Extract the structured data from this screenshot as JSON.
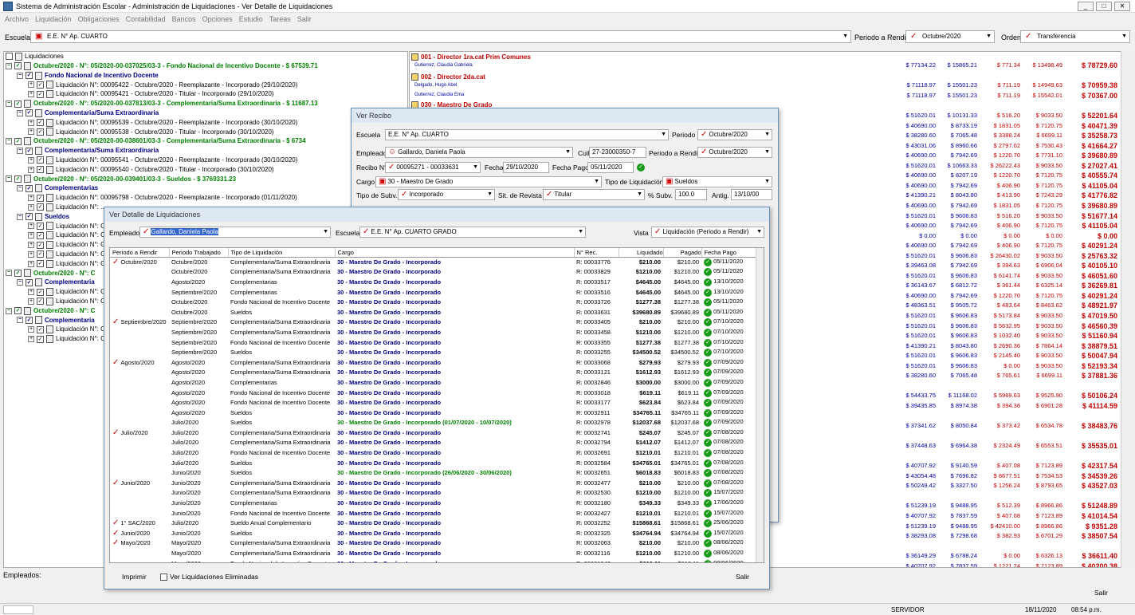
{
  "window": {
    "title": "Sistema de Administración Escolar - Administración de Liquidaciones - Ver Detalle de Liquidaciones"
  },
  "menu": [
    "Archivo",
    "Liquidación",
    "Obligaciones",
    "Contabilidad",
    "Bancos",
    "Opciones",
    "Estudio",
    "Tareas",
    "Salir"
  ],
  "filters": {
    "escuela_label": "Escuela",
    "escuela_value": "E.E. N° Ap. CUARTO",
    "periodo_label": "Periodo a Rendir",
    "periodo_value": "Octubre/2020",
    "orden_label": "Orden",
    "orden_value": "Transferencia"
  },
  "tree": {
    "root": "Liquidaciones",
    "nodes": [
      {
        "t": "Octubre/2020 - N°: 05/2020-00-037025/03-3 - Fondo Nacional de Incentivo Docente - $ 67539.71",
        "k": "green",
        "l": 0
      },
      {
        "t": "Fondo Nacional de Incentivo Docente",
        "k": "blue",
        "l": 1
      },
      {
        "t": "Liquidación N°: 00095422 - Octubre/2020 - Reemplazante - Incorporado (29/10/2020)",
        "k": "doc",
        "l": 2
      },
      {
        "t": "Liquidación N°: 00095421 - Octubre/2020 - Titular - Incorporado (29/10/2020)",
        "k": "doc",
        "l": 2
      },
      {
        "t": "Octubre/2020 - N°: 05/2020-00-037813/03-3 - Complementaria/Suma Extraordinaria - $ 11687.13",
        "k": "green",
        "l": 0
      },
      {
        "t": "Complementaria/Suma Extraordinaria",
        "k": "blue",
        "l": 1
      },
      {
        "t": "Liquidación N°: 00095539 - Octubre/2020 - Reemplazante - Incorporado (30/10/2020)",
        "k": "doc",
        "l": 2
      },
      {
        "t": "Liquidación N°: 00095538 - Octubre/2020 - Titular - Incorporado (30/10/2020)",
        "k": "doc",
        "l": 2
      },
      {
        "t": "Octubre/2020 - N°: 05/2020-00-038601/03-3 - Complementaria/Suma Extraordinaria - $ 6734",
        "k": "green",
        "l": 0
      },
      {
        "t": "Complementaria/Suma Extraordinaria",
        "k": "blue",
        "l": 1
      },
      {
        "t": "Liquidación N°: 00095541 - Octubre/2020 - Reemplazante - Incorporado (30/10/2020)",
        "k": "doc",
        "l": 2
      },
      {
        "t": "Liquidación N°: 00095540 - Octubre/2020 - Titular - Incorporado (30/10/2020)",
        "k": "doc",
        "l": 2
      },
      {
        "t": "Octubre/2020 - N°: 05/2020-00-039401/03-3 - Sueldos - $ 3769331.23",
        "k": "green",
        "l": 0
      },
      {
        "t": "Complementarias",
        "k": "blue",
        "l": 1
      },
      {
        "t": "Liquidación N°: 00095798 - Octubre/2020 - Reemplazante - Incorporado (01/11/2020)",
        "k": "doc",
        "l": 2
      },
      {
        "t": "Liquidación N°: ...",
        "k": "doc",
        "l": 2
      },
      {
        "t": "Sueldos",
        "k": "blue",
        "l": 1
      },
      {
        "t": "Liquidación N°: C",
        "k": "doc",
        "l": 2
      },
      {
        "t": "Liquidación N°: C",
        "k": "doc",
        "l": 2
      },
      {
        "t": "Liquidación N°: C",
        "k": "doc",
        "l": 2
      },
      {
        "t": "Liquidación N°: C",
        "k": "doc",
        "l": 2
      },
      {
        "t": "Liquidación N°: C",
        "k": "doc",
        "l": 2
      },
      {
        "t": "Octubre/2020 - N°: C",
        "k": "green",
        "l": 0
      },
      {
        "t": "Complementaria",
        "k": "blue",
        "l": 1
      },
      {
        "t": "Liquidación N°: C",
        "k": "doc",
        "l": 2
      },
      {
        "t": "Liquidación N°: C",
        "k": "doc",
        "l": 2
      },
      {
        "t": "Octubre/2020 - N°: C",
        "k": "green",
        "l": 0
      },
      {
        "t": "Complementaria",
        "k": "blue",
        "l": 1
      },
      {
        "t": "Liquidación N°: C",
        "k": "doc",
        "l": 2
      },
      {
        "t": "Liquidación N°: C",
        "k": "doc",
        "l": 2
      }
    ]
  },
  "right_headers": [
    {
      "t": "001 - Director 1ra.cat Prim Comunes",
      "sub": "Gutierrez, Claudia Gabriela"
    },
    {
      "t": "002 - Director 2da.cat",
      "sub": "Delgado, Hugo Abel"
    },
    {
      "t": "030 - Maestro De Grado",
      "sub": ""
    }
  ],
  "right_sub2": "Gutierrez, Claudia Ema",
  "right_rows": [
    [
      "$ 77134.22",
      "$ 15865.21",
      "$ 771.34",
      "$ 13498.49",
      "$ 78729.60"
    ],
    [
      "$ 71118.97",
      "$ 15501.23",
      "$ 711.19",
      "$ 14949.63",
      "$ 70959.38"
    ],
    [
      "$ 71118.97",
      "$ 15501.23",
      "$ 711.19",
      "$ 15542.01",
      "$ 70367.00"
    ],
    [
      "$ 51620.01",
      "$ 10131.33",
      "$ 516.20",
      "$ 9033.50",
      "$ 52201.64"
    ],
    [
      "$ 40690.00",
      "$ 8733.19",
      "$ 1831.05",
      "$ 7120.75",
      "$ 40471.39"
    ],
    [
      "$ 38280.60",
      "$ 7065.48",
      "$ 3388.24",
      "$ 6699.11",
      "$ 35258.73"
    ],
    [
      "$ 43031.06",
      "$ 8960.66",
      "$ 2797.02",
      "$ 7530.43",
      "$ 41664.27"
    ],
    [
      "$ 40690.00",
      "$ 7942.69",
      "$ 1220.70",
      "$ 7731.10",
      "$ 39680.89"
    ],
    [
      "$ 51620.01",
      "$ 10663.33",
      "$ 26222.43",
      "$ 9033.50",
      "$ 27027.41"
    ],
    [
      "$ 40690.00",
      "$ 8207.19",
      "$ 1220.70",
      "$ 7120.75",
      "$ 40555.74"
    ],
    [
      "$ 40690.00",
      "$ 7942.69",
      "$ 406.90",
      "$ 7120.75",
      "$ 41105.04"
    ],
    [
      "$ 41390.21",
      "$ 8043.80",
      "$ 413.90",
      "$ 7243.29",
      "$ 41776.82"
    ],
    [
      "$ 40690.00",
      "$ 7942.69",
      "$ 1831.05",
      "$ 7120.75",
      "$ 39680.89"
    ],
    [
      "$ 51620.01",
      "$ 9606.83",
      "$ 516.20",
      "$ 9033.50",
      "$ 51677.14"
    ],
    [
      "$ 40690.00",
      "$ 7942.69",
      "$ 406.90",
      "$ 7120.75",
      "$ 41105.04"
    ],
    [
      "$ 0.00",
      "$ 0.00",
      "$ 0.00",
      "$ 0.00",
      "$ 0.00"
    ],
    [
      "$ 40690.00",
      "$ 7942.69",
      "$ 406.90",
      "$ 7120.75",
      "$ 40291.24"
    ],
    [
      "$ 51620.01",
      "$ 9606.83",
      "$ 26430.02",
      "$ 9033.50",
      "$ 25763.32"
    ],
    [
      "$ 39463.08",
      "$ 7942.69",
      "$ 394.63",
      "$ 6906.04",
      "$ 40105.10"
    ],
    [
      "$ 51620.01",
      "$ 9606.83",
      "$ 6141.74",
      "$ 9033.50",
      "$ 46051.60"
    ],
    [
      "$ 36143.67",
      "$ 6812.72",
      "$ 361.44",
      "$ 6325.14",
      "$ 36269.81"
    ],
    [
      "$ 40690.00",
      "$ 7942.69",
      "$ 1220.70",
      "$ 7120.75",
      "$ 40291.24"
    ],
    [
      "$ 48363.51",
      "$ 9505.72",
      "$ 483.64",
      "$ 8463.62",
      "$ 48921.97"
    ],
    [
      "$ 51620.01",
      "$ 9606.83",
      "$ 5173.84",
      "$ 9033.50",
      "$ 47019.50"
    ],
    [
      "$ 51620.01",
      "$ 9606.83",
      "$ 5632.95",
      "$ 9033.50",
      "$ 46560.39"
    ],
    [
      "$ 51620.01",
      "$ 9606.83",
      "$ 1032.40",
      "$ 9033.50",
      "$ 51160.94"
    ],
    [
      "$ 41390.21",
      "$ 8043.80",
      "$ 2690.36",
      "$ 7864.14",
      "$ 38879.51"
    ],
    [
      "$ 51620.01",
      "$ 9606.83",
      "$ 2145.40",
      "$ 9033.50",
      "$ 50047.94"
    ],
    [
      "$ 51620.01",
      "$ 9606.83",
      "$ 0.00",
      "$ 9033.50",
      "$ 52193.34"
    ],
    [
      "$ 38280.60",
      "$ 7065.48",
      "$ 765.61",
      "$ 6699.11",
      "$ 37881.36"
    ],
    [
      "",
      "",
      "",
      "",
      ""
    ],
    [
      "$ 54433.75",
      "$ 11168.02",
      "$ 5969.63",
      "$ 9525.90",
      "$ 50106.24"
    ],
    [
      "$ 39435.85",
      "$ 8974.38",
      "$ 394.36",
      "$ 6901.28",
      "$ 41114.59"
    ],
    [
      "",
      "",
      "",
      "",
      ""
    ],
    [
      "$ 37341.62",
      "$ 8050.84",
      "$ 373.42",
      "$ 6534.78",
      "$ 38483.76"
    ],
    [
      "",
      "",
      "",
      "",
      ""
    ],
    [
      "$ 37448.63",
      "$ 6964.38",
      "$ 2324.49",
      "$ 6553.51",
      "$ 35535.01"
    ],
    [
      "",
      "",
      "",
      "",
      ""
    ],
    [
      "$ 40707.92",
      "$ 9140.59",
      "$ 407.08",
      "$ 7123.89",
      "$ 42317.54"
    ],
    [
      "$ 43054.48",
      "$ 7696.82",
      "$ 8677.51",
      "$ 7534.53",
      "$ 34539.26"
    ],
    [
      "$ 50249.42",
      "$ 3327.50",
      "$ 1256.24",
      "$ 8793.65",
      "$ 43527.03"
    ],
    [
      "",
      "",
      "",
      "",
      ""
    ],
    [
      "$ 51239.19",
      "$ 9488.95",
      "$ 512.39",
      "$ 8966.86",
      "$ 51248.89"
    ],
    [
      "$ 40707.92",
      "$ 7837.59",
      "$ 407.08",
      "$ 7123.89",
      "$ 41014.54"
    ],
    [
      "$ 51239.19",
      "$ 9488.95",
      "$ 42410.00",
      "$ 8966.86",
      "$ 9351.28"
    ],
    [
      "$ 38293.08",
      "$ 7298.68",
      "$ 382.93",
      "$ 6701.29",
      "$ 38507.54"
    ],
    [
      "",
      "",
      "",
      "",
      ""
    ],
    [
      "$ 36149.29",
      "$ 6788.24",
      "$ 0.00",
      "$ 6326.13",
      "$ 36611.40"
    ],
    [
      "$ 40707.92",
      "$ 7837.59",
      "$ 1221.24",
      "$ 7123.89",
      "$ 40200.38"
    ]
  ],
  "bottom": {
    "empleados_label": "Empleados:",
    "salir": "Salir"
  },
  "status": {
    "server": "SERVIDOR",
    "date": "18/11/2020",
    "time": "08:54 p.m."
  },
  "recibo": {
    "title": "Ver Recibo",
    "escuela_label": "Escuela",
    "escuela_value": "E.E. N° Ap. CUARTO",
    "periodo_label": "Periodo",
    "periodo_value": "Octubre/2020",
    "empleado_label": "Empleado",
    "empleado_value": "Gallardo, Daniela Paola",
    "cuil_label": "Cuil",
    "cuil_value": "27-23000350-7",
    "per_rendir_label": "Periodo a Rendir",
    "per_rendir_value": "Octubre/2020",
    "recibo_label": "Recibo N°",
    "recibo_value": "00095271 - 00033631",
    "fecha_label": "Fecha",
    "fecha_value": "29/10/2020",
    "fechapago_label": "Fecha Pago",
    "fechapago_value": "05/11/2020",
    "cargo_label": "Cargo",
    "cargo_value": "30 - Maestro De Grado",
    "tipoliq_label": "Tipo de Liquidación",
    "tipoliq_value": "Sueldos",
    "tiposubv_label": "Tipo de Subv.",
    "tiposubv_value": "Incorporado",
    "sitrev_label": "Sit. de Revista",
    "sitrev_value": "Titular",
    "psubv_label": "% Subv.",
    "psubv_value": "100.0",
    "antig_label": "Antig.",
    "antig_value": "13/10/00"
  },
  "detalle": {
    "title": "Ver Detalle de Liquidaciones",
    "empleado_label": "Empleado",
    "empleado_value": "Gallardo, Daniela Paola",
    "escuela_label": "Escuela",
    "escuela_value": "E.E. N° Ap. CUARTO GRADO",
    "vista_label": "Vista",
    "vista_value": "Liquidación (Periodo a Rendir)",
    "columns": [
      "Periodo a Rendir",
      "Periodo Trabajado",
      "Tipo de Liquidación",
      "Cargo",
      "N° Rec.",
      "Liquidado",
      "Pagado",
      "Fecha Pago"
    ],
    "rows": [
      [
        "Octubre/2020",
        "Octubre/2020",
        "Complementaria/Suma Extraordinaria",
        "30 - Maestro De Grado - Incorporado",
        "R: 00033776",
        "$210.00",
        "$210.00",
        "05/11/2020",
        ""
      ],
      [
        "",
        "Octubre/2020",
        "Complementaria/Suma Extraordinaria",
        "30 - Maestro De Grado - Incorporado",
        "R: 00033829",
        "$1210.00",
        "$1210.00",
        "05/11/2020",
        ""
      ],
      [
        "",
        "Agosto/2020",
        "Complementarias",
        "30 - Maestro De Grado - Incorporado",
        "R: 00033517",
        "$4645.00",
        "$4645.00",
        "13/10/2020",
        ""
      ],
      [
        "",
        "Septiembre/2020",
        "Complementarias",
        "30 - Maestro De Grado - Incorporado",
        "R: 00033516",
        "$4645.00",
        "$4645.00",
        "13/10/2020",
        ""
      ],
      [
        "",
        "Octubre/2020",
        "Fondo Nacional de Incentivo Docente",
        "30 - Maestro De Grado - Incorporado",
        "R: 00033726",
        "$1277.38",
        "$1277.38",
        "05/11/2020",
        ""
      ],
      [
        "",
        "Octubre/2020",
        "Sueldos",
        "30 - Maestro De Grado - Incorporado",
        "R: 00033631",
        "$39680.89",
        "$39680.89",
        "05/11/2020",
        ""
      ],
      [
        "Septiembre/2020",
        "Septiembre/2020",
        "Complementaria/Suma Extraordinaria",
        "30 - Maestro De Grado - Incorporado",
        "R: 00033405",
        "$210.00",
        "$210.00",
        "07/10/2020",
        ""
      ],
      [
        "",
        "Septiembre/2020",
        "Complementaria/Suma Extraordinaria",
        "30 - Maestro De Grado - Incorporado",
        "R: 00033458",
        "$1210.00",
        "$1210.00",
        "07/10/2020",
        ""
      ],
      [
        "",
        "Septiembre/2020",
        "Fondo Nacional de Incentivo Docente",
        "30 - Maestro De Grado - Incorporado",
        "R: 00033355",
        "$1277.38",
        "$1277.38",
        "07/10/2020",
        ""
      ],
      [
        "",
        "Septiembre/2020",
        "Sueldos",
        "30 - Maestro De Grado - Incorporado",
        "R: 00033255",
        "$34500.52",
        "$34500.52",
        "07/10/2020",
        ""
      ],
      [
        "Agosto/2020",
        "Agosto/2020",
        "Complementaria/Suma Extraordinaria",
        "30 - Maestro De Grado - Incorporado",
        "R: 00033068",
        "$279.93",
        "$279.93",
        "07/09/2020",
        ""
      ],
      [
        "",
        "Agosto/2020",
        "Complementaria/Suma Extraordinaria",
        "30 - Maestro De Grado - Incorporado",
        "R: 00033121",
        "$1612.93",
        "$1612.93",
        "07/09/2020",
        ""
      ],
      [
        "",
        "Agosto/2020",
        "Complementarias",
        "30 - Maestro De Grado - Incorporado",
        "R: 00032846",
        "$3000.00",
        "$3000.00",
        "07/09/2020",
        ""
      ],
      [
        "",
        "Agosto/2020",
        "Fondo Nacional de Incentivo Docente",
        "30 - Maestro De Grado - Incorporado",
        "R: 00033018",
        "$619.11",
        "$619.11",
        "07/09/2020",
        ""
      ],
      [
        "",
        "Agosto/2020",
        "Fondo Nacional de Incentivo Docente",
        "30 - Maestro De Grado - Incorporado",
        "R: 00033177",
        "$623.84",
        "$623.84",
        "07/09/2020",
        ""
      ],
      [
        "",
        "Agosto/2020",
        "Sueldos",
        "30 - Maestro De Grado - Incorporado",
        "R: 00032911",
        "$34765.11",
        "$34765.11",
        "07/09/2020",
        ""
      ],
      [
        "",
        "Julio/2020",
        "Sueldos",
        "30 - Maestro De Grado - Incorporado (01/07/2020 - 10/07/2020)",
        "R: 00032978",
        "$12037.68",
        "$12037.68",
        "07/09/2020",
        "g"
      ],
      [
        "Julio/2020",
        "Julio/2020",
        "Complementaria/Suma Extraordinaria",
        "30 - Maestro De Grado - Incorporado",
        "R: 00032741",
        "$245.07",
        "$245.07",
        "07/08/2020",
        ""
      ],
      [
        "",
        "Julio/2020",
        "Complementaria/Suma Extraordinaria",
        "30 - Maestro De Grado - Incorporado",
        "R: 00032794",
        "$1412.07",
        "$1412.07",
        "07/08/2020",
        ""
      ],
      [
        "",
        "Julio/2020",
        "Fondo Nacional de Incentivo Docente",
        "30 - Maestro De Grado - Incorporado",
        "R: 00032691",
        "$1210.01",
        "$1210.01",
        "07/08/2020",
        ""
      ],
      [
        "",
        "Julio/2020",
        "Sueldos",
        "30 - Maestro De Grado - Incorporado",
        "R: 00032584",
        "$34765.01",
        "$34765.01",
        "07/08/2020",
        ""
      ],
      [
        "",
        "Junio/2020",
        "Sueldos",
        "30 - Maestro De Grado - Incorporado (26/06/2020 - 30/06/2020)",
        "R: 00032651",
        "$6018.83",
        "$6018.83",
        "07/08/2020",
        "g"
      ],
      [
        "Junio/2020",
        "Junio/2020",
        "Complementaria/Suma Extraordinaria",
        "30 - Maestro De Grado - Incorporado",
        "R: 00032477",
        "$210.00",
        "$210.00",
        "07/08/2020",
        ""
      ],
      [
        "",
        "Junio/2020",
        "Complementaria/Suma Extraordinaria",
        "30 - Maestro De Grado - Incorporado",
        "R: 00032530",
        "$1210.00",
        "$1210.00",
        "15/07/2020",
        ""
      ],
      [
        "",
        "Junio/2020",
        "Complementarias",
        "30 - Maestro De Grado - Incorporado",
        "R: 00032180",
        "$349.33",
        "$349.33",
        "17/06/2020",
        ""
      ],
      [
        "",
        "Junio/2020",
        "Fondo Nacional de Incentivo Docente",
        "30 - Maestro De Grado - Incorporado",
        "R: 00032427",
        "$1210.01",
        "$1210.01",
        "15/07/2020",
        ""
      ],
      [
        "1° SAC/2020",
        "Julio/2020",
        "Sueldo Anual Complementario",
        "30 - Maestro De Grado - Incorporado",
        "R: 00032252",
        "$15868.61",
        "$15868.61",
        "25/06/2020",
        ""
      ],
      [
        "Junio/2020",
        "Junio/2020",
        "Sueldos",
        "30 - Maestro De Grado - Incorporado",
        "R: 00032325",
        "$34764.94",
        "$34764.94",
        "15/07/2020",
        ""
      ],
      [
        "Mayo/2020",
        "Mayo/2020",
        "Complementaria/Suma Extraordinaria",
        "30 - Maestro De Grado - Incorporado",
        "R: 00032063",
        "$210.00",
        "$210.00",
        "08/06/2020",
        ""
      ],
      [
        "",
        "Mayo/2020",
        "Complementaria/Suma Extraordinaria",
        "30 - Maestro De Grado - Incorporado",
        "R: 00032116",
        "$1210.00",
        "$1210.00",
        "08/06/2020",
        ""
      ],
      [
        "",
        "Mayo/2020",
        "Fondo Nacional de Incentivo Docente",
        "30 - Maestro De Grado - Incorporado",
        "R: 00031942",
        "$619.11",
        "$619.11",
        "08/06/2020",
        ""
      ]
    ],
    "imprimir": "Imprimir",
    "ver_eliminadas": "Ver Liquidaciones Eliminadas",
    "salir": "Salir"
  }
}
